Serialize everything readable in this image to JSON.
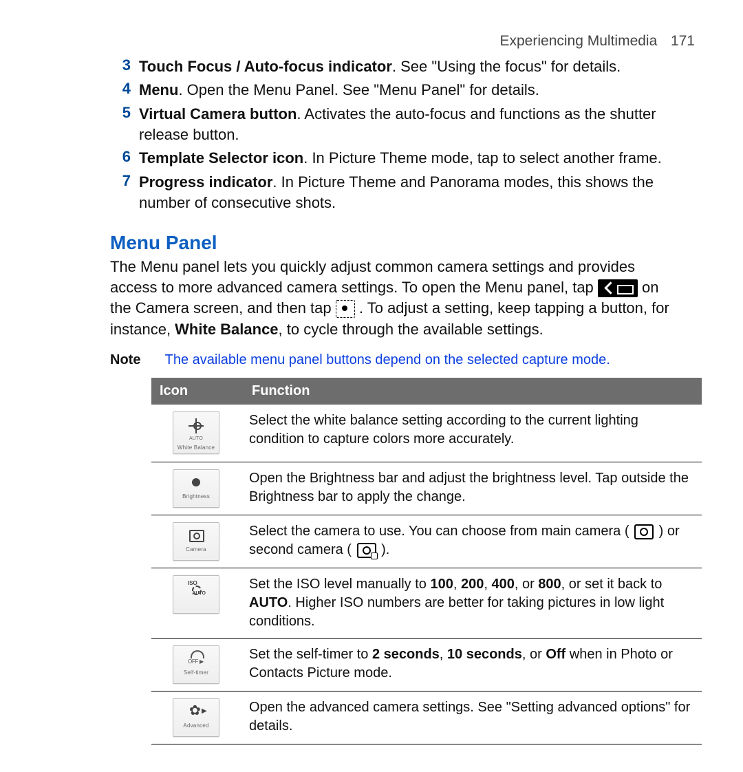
{
  "header": {
    "section": "Experiencing Multimedia",
    "page": "171"
  },
  "list": [
    {
      "n": "3",
      "bold": "Touch Focus / Auto-focus indicator",
      "rest": ". See \"Using the focus\" for details."
    },
    {
      "n": "4",
      "bold": "Menu",
      "rest": ". Open the Menu Panel. See \"Menu Panel\" for details."
    },
    {
      "n": "5",
      "bold": "Virtual Camera button",
      "rest": ". Activates the auto-focus and functions as the shutter release button."
    },
    {
      "n": "6",
      "bold": "Template Selector icon",
      "rest": ". In Picture Theme mode, tap to select another frame."
    },
    {
      "n": "7",
      "bold": "Progress indicator",
      "rest": ". In Picture Theme and Panorama modes, this shows the number of consecutive shots."
    }
  ],
  "section_title": "Menu Panel",
  "para": {
    "a": "The Menu panel lets you quickly adjust common camera settings and provides access to more advanced camera settings. To open the Menu panel, tap ",
    "b": " on the Camera screen, and then tap ",
    "c": " . To adjust a setting, keep tapping a button, for instance, ",
    "bold": "White Balance",
    "d": ", to cycle through the available settings."
  },
  "note": {
    "label": "Note",
    "text": "The available menu panel buttons depend on the selected capture mode."
  },
  "table": {
    "head_icon": "Icon",
    "head_function": "Function",
    "rows": [
      {
        "icon_caption": "White Balance",
        "icon_name": "white-balance-icon",
        "func": "Select the white balance setting according to the current lighting condition to capture colors more accurately."
      },
      {
        "icon_caption": "Brightness",
        "icon_name": "brightness-icon",
        "func": "Open the Brightness bar and adjust the brightness level. Tap outside the Brightness bar to apply the change."
      },
      {
        "icon_caption": "Camera",
        "icon_name": "camera-select-icon",
        "func_a": "Select the camera to use. You can choose from main camera ( ",
        "func_b": " ) or second camera ( ",
        "func_c": " )."
      },
      {
        "icon_caption": "",
        "icon_name": "iso-icon",
        "func_a": "Set the ISO level manually to ",
        "b1": "100",
        "s1": ", ",
        "b2": "200",
        "s2": ", ",
        "b3": "400",
        "s3": ", or ",
        "b4": "800",
        "func_b": ", or set it back to ",
        "b5": "AUTO",
        "func_c": ". Higher ISO numbers are better for taking pictures in low light conditions."
      },
      {
        "icon_caption": "Self-timer",
        "icon_name": "self-timer-icon",
        "func_a": "Set the self-timer to ",
        "b1": "2 seconds",
        "s1": ", ",
        "b2": "10 seconds",
        "s2": ", or ",
        "b3": "Off",
        "func_b": " when in Photo or Contacts Picture mode."
      },
      {
        "icon_caption": "Advanced",
        "icon_name": "advanced-icon",
        "func": "Open the advanced camera settings. See \"Setting advanced options\" for details."
      }
    ]
  }
}
